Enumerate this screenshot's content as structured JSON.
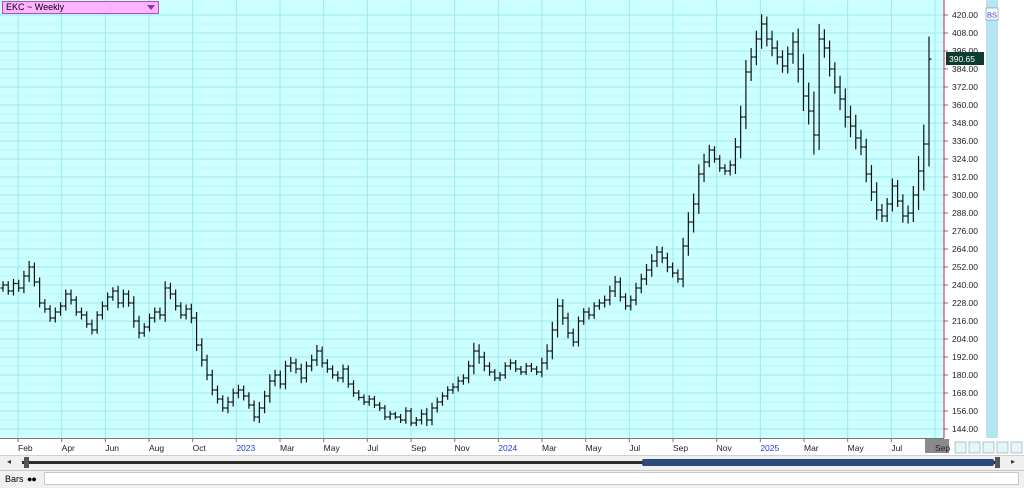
{
  "header": {
    "symbol_label": "EKC ~ Weekly"
  },
  "price_axis": {
    "labels": [
      "420.00",
      "408.00",
      "396.00",
      "384.00",
      "372.00",
      "360.00",
      "348.00",
      "336.00",
      "324.00",
      "312.00",
      "300.00",
      "288.00",
      "276.00",
      "264.00",
      "252.00",
      "240.00",
      "228.00",
      "216.00",
      "204.00",
      "192.00",
      "180.00",
      "168.00",
      "156.00",
      "144.00"
    ],
    "last_price": "390.65",
    "badge": "BS"
  },
  "colors": {
    "plot_bg": "#ccffff",
    "grid": "#9ce8f2",
    "bars": "#111111",
    "right_line": "#cc2244",
    "price_tag": "#0d3b2f",
    "axis_bg": "#ffffff"
  },
  "time_axis": {
    "labels": [
      {
        "text": "Feb",
        "is_year": false
      },
      {
        "text": "Apr",
        "is_year": false
      },
      {
        "text": "Jun",
        "is_year": false
      },
      {
        "text": "Aug",
        "is_year": false
      },
      {
        "text": "Oct",
        "is_year": false
      },
      {
        "text": "2023",
        "is_year": true
      },
      {
        "text": "Mar",
        "is_year": false
      },
      {
        "text": "May",
        "is_year": false
      },
      {
        "text": "Jul",
        "is_year": false
      },
      {
        "text": "Sep",
        "is_year": false
      },
      {
        "text": "Nov",
        "is_year": false
      },
      {
        "text": "2024",
        "is_year": true
      },
      {
        "text": "Mar",
        "is_year": false
      },
      {
        "text": "May",
        "is_year": false
      },
      {
        "text": "Jul",
        "is_year": false
      },
      {
        "text": "Sep",
        "is_year": false
      },
      {
        "text": "Nov",
        "is_year": false
      },
      {
        "text": "2025",
        "is_year": true
      },
      {
        "text": "Mar",
        "is_year": false
      },
      {
        "text": "May",
        "is_year": false
      },
      {
        "text": "Jul",
        "is_year": false
      },
      {
        "text": "Sep",
        "is_year": false
      }
    ]
  },
  "bottom": {
    "bars_label": "Bars"
  },
  "chart_data": {
    "type": "ohlc",
    "symbol": "EKC",
    "interval": "Weekly",
    "ylim": [
      138,
      430
    ],
    "y_ticks": [
      420,
      408,
      396,
      384,
      372,
      360,
      348,
      336,
      324,
      312,
      300,
      288,
      276,
      264,
      252,
      240,
      228,
      216,
      204,
      192,
      180,
      168,
      156,
      144
    ],
    "last": 390.65,
    "closes": [
      240,
      236,
      241,
      238,
      246,
      252,
      242,
      228,
      224,
      218,
      222,
      226,
      234,
      230,
      222,
      220,
      214,
      210,
      220,
      226,
      232,
      236,
      228,
      234,
      228,
      216,
      208,
      212,
      218,
      222,
      220,
      238,
      234,
      226,
      220,
      224,
      218,
      200,
      190,
      180,
      170,
      164,
      158,
      162,
      168,
      170,
      166,
      160,
      152,
      158,
      166,
      176,
      180,
      174,
      186,
      188,
      184,
      178,
      186,
      190,
      196,
      188,
      184,
      180,
      178,
      184,
      174,
      168,
      165,
      162,
      164,
      160,
      158,
      152,
      154,
      152,
      150,
      156,
      148,
      150,
      154,
      150,
      158,
      162,
      166,
      170,
      172,
      176,
      178,
      186,
      196,
      192,
      186,
      182,
      178,
      180,
      186,
      188,
      184,
      182,
      186,
      184,
      182,
      188,
      196,
      210,
      226,
      218,
      208,
      202,
      216,
      222,
      220,
      226,
      228,
      230,
      236,
      242,
      232,
      226,
      230,
      238,
      244,
      250,
      256,
      262,
      258,
      252,
      248,
      244,
      266,
      282,
      294,
      314,
      322,
      330,
      324,
      318,
      316,
      320,
      332,
      352,
      382,
      392,
      404,
      414,
      404,
      398,
      392,
      386,
      394,
      402,
      384,
      366,
      356,
      340,
      404,
      398,
      384,
      372,
      364,
      352,
      346,
      338,
      332,
      314,
      302,
      290,
      286,
      294,
      306,
      296,
      286,
      288,
      300,
      316,
      334,
      390.65
    ],
    "ranges": [
      10,
      10,
      12,
      10,
      14,
      16,
      12,
      12,
      10,
      10,
      12,
      10,
      12,
      12,
      10,
      12,
      10,
      12,
      10,
      12,
      12,
      10,
      14,
      12,
      10,
      18,
      14,
      10,
      12,
      12,
      12,
      18,
      14,
      12,
      10,
      12,
      14,
      16,
      18,
      14,
      14,
      12,
      10,
      14,
      12,
      14,
      12,
      10,
      12,
      16,
      14,
      18,
      14,
      12,
      14,
      16,
      12,
      14,
      12,
      14,
      16,
      12,
      10,
      10,
      10,
      12,
      10,
      10,
      8,
      8,
      10,
      8,
      8,
      8,
      8,
      6,
      8,
      10,
      8,
      8,
      12,
      16,
      14,
      12,
      10,
      10,
      10,
      12,
      10,
      14,
      22,
      18,
      14,
      10,
      8,
      8,
      10,
      10,
      8,
      8,
      8,
      8,
      8,
      14,
      18,
      22,
      20,
      18,
      14,
      12,
      12,
      10,
      12,
      10,
      10,
      12,
      14,
      16,
      12,
      10,
      12,
      14,
      14,
      16,
      18,
      16,
      14,
      14,
      12,
      10,
      22,
      26,
      28,
      26,
      22,
      14,
      10,
      10,
      10,
      12,
      24,
      30,
      32,
      24,
      22,
      26,
      20,
      22,
      20,
      18,
      20,
      26,
      36,
      40,
      36,
      52,
      40,
      26,
      20,
      18,
      30,
      28,
      30,
      30,
      22,
      22,
      24,
      26,
      16,
      16,
      20,
      16,
      18,
      20,
      24,
      40,
      52,
      60
    ]
  }
}
